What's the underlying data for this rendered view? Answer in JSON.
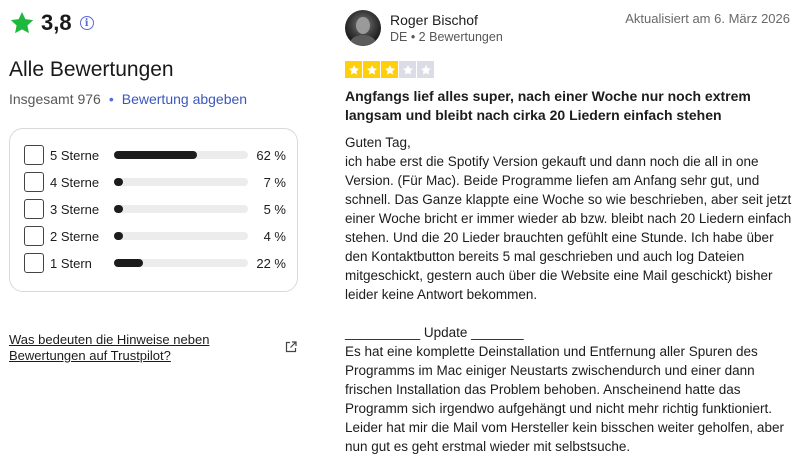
{
  "summary": {
    "rating": "3,8",
    "title": "Alle Bewertungen",
    "total_label": "Insgesamt 976",
    "write_review_label": "Bewertung abgeben"
  },
  "distribution": [
    {
      "label": "5 Sterne",
      "pct": "62 %",
      "fraction": 0.62
    },
    {
      "label": "4 Sterne",
      "pct": "7 %",
      "fraction": 0.07
    },
    {
      "label": "3 Sterne",
      "pct": "5 %",
      "fraction": 0.05
    },
    {
      "label": "2 Sterne",
      "pct": "4 %",
      "fraction": 0.04
    },
    {
      "label": "1 Stern",
      "pct": "22 %",
      "fraction": 0.22
    }
  ],
  "help_link": "Was bedeuten die Hinweise neben Bewertungen auf Trustpilot?",
  "review": {
    "author": "Roger Bischof",
    "meta": "DE • 2 Bewertungen",
    "updated": "Aktualisiert am 6. März 2026",
    "stars": 3,
    "max_stars": 5,
    "title": "Angfangs lief alles super, nach einer Woche nur noch extrem langsam und bleibt nach cirka 20 Liedern einfach stehen",
    "greeting": "Guten Tag,",
    "paragraph1": "ich habe erst die Spotify Version gekauft und dann noch die all in one Version. (Für Mac). Beide Programme liefen am Anfang sehr gut, und schnell. Das Ganze klappte eine Woche so wie beschrieben, aber seit jetzt einer Woche bricht er immer wieder ab bzw. bleibt nach 20 Liedern einfach stehen. Und die 20 Lieder brauchten gefühlt eine Stunde. Ich habe über den Kontaktbutton bereits 5 mal geschrieben und auch log Dateien mitgeschickt, gestern auch über die Website eine Mail geschickt) bisher leider keine Antwort bekommen.",
    "update_heading": "__________ Update _______",
    "paragraph2": "Es hat eine komplette Deinstallation und Entfernung aller Spuren des Programms im Mac einiger Neustarts zwischendurch und einer dann frischen Installation das Problem behoben. Anscheinend hatte das Programm sich irgendwo aufgehängt und nicht mehr richtig funktioniert. Leider hat mir die Mail vom Hersteller kein bisschen weiter geholfen, aber nun gut es geht erstmal wieder mit selbstsuche."
  },
  "colors": {
    "trustpilot_green": "#1fb83e",
    "star_filled": "#fecf0a",
    "star_empty": "#dcdce6",
    "link_blue": "#3c57bc"
  }
}
